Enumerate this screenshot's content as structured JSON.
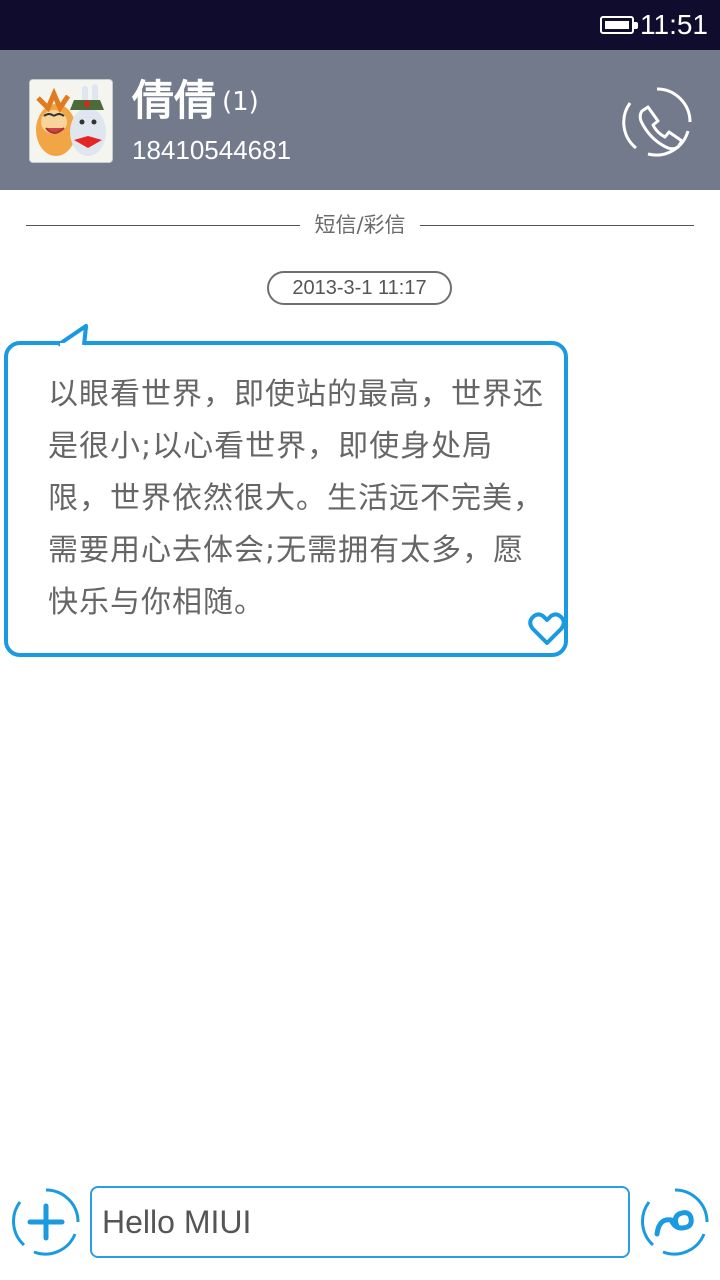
{
  "status_bar": {
    "time": "11:51",
    "battery_icon": "battery-full-icon"
  },
  "header": {
    "contact_name": "倩倩",
    "unread_count": "(1)",
    "phone_number": "18410544681",
    "call_icon": "phone-call-icon"
  },
  "conversation": {
    "divider_label": "短信/彩信",
    "timestamp": "2013-3-1 11:17",
    "message_text": "以眼看世界，即使站的最高，世界还是很小;以心看世界，即使身处局限，世界依然很大。生活远不完美，需要用心去体会;无需拥有太多，愿快乐与你相随。",
    "favorite_icon": "heart-outline-icon"
  },
  "composer": {
    "input_value": "Hello MIUI",
    "add_icon": "plus-icon",
    "send_icon": "send-icon"
  },
  "colors": {
    "status_bar_bg": "#0f0c2e",
    "header_bg": "#737a8c",
    "accent_blue": "#1a9ae0",
    "text_gray": "#666666"
  }
}
